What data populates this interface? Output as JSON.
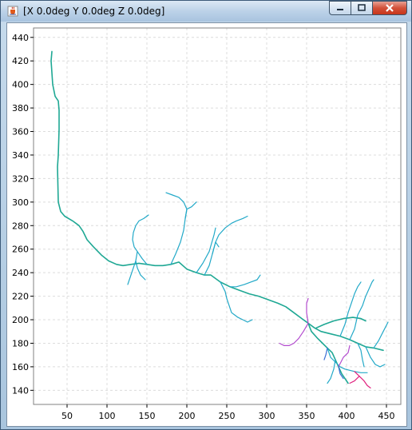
{
  "window": {
    "title": "[X 0.0deg Y 0.0deg Z 0.0deg]",
    "controls": {
      "minimize": "minimize",
      "maximize": "maximize",
      "close": "close"
    },
    "icon": "java-cup-icon"
  },
  "colors": {
    "grid": "#dcdcdc",
    "axis": "#000000",
    "trunk": "#1fa894",
    "branch": "#22a9c8",
    "purple": "#b34ccf",
    "pink": "#e0227f",
    "blue": "#3a6fd6"
  },
  "chart_data": {
    "type": "line",
    "title": "",
    "xlabel": "",
    "ylabel": "",
    "xlim": [
      8,
      468
    ],
    "ylim": [
      128,
      448
    ],
    "xticks": [
      50,
      100,
      150,
      200,
      250,
      300,
      350,
      400,
      450
    ],
    "yticks": [
      140,
      160,
      180,
      200,
      220,
      240,
      260,
      280,
      300,
      320,
      340,
      360,
      380,
      400,
      420,
      440
    ],
    "grid": true,
    "series": [
      {
        "color": "trunk",
        "points": [
          [
            31,
            428
          ],
          [
            30,
            420
          ],
          [
            32,
            400
          ],
          [
            35,
            390
          ],
          [
            39,
            386
          ],
          [
            40,
            378
          ],
          [
            40,
            362
          ],
          [
            39,
            340
          ],
          [
            38,
            330
          ],
          [
            39,
            300
          ],
          [
            42,
            292
          ],
          [
            47,
            288
          ],
          [
            57,
            284
          ],
          [
            65,
            280
          ],
          [
            70,
            275
          ],
          [
            75,
            268
          ],
          [
            83,
            262
          ],
          [
            93,
            255
          ],
          [
            102,
            250
          ],
          [
            112,
            247
          ],
          [
            120,
            246
          ],
          [
            130,
            247
          ],
          [
            140,
            248
          ],
          [
            150,
            247
          ],
          [
            160,
            246
          ],
          [
            170,
            246
          ],
          [
            180,
            247
          ],
          [
            190,
            249
          ],
          [
            200,
            243
          ],
          [
            212,
            240
          ],
          [
            222,
            238
          ],
          [
            230,
            238
          ],
          [
            242,
            232
          ],
          [
            254,
            228
          ],
          [
            266,
            225
          ],
          [
            278,
            222
          ],
          [
            290,
            220
          ],
          [
            302,
            217
          ],
          [
            314,
            214
          ],
          [
            324,
            211
          ],
          [
            334,
            206
          ],
          [
            344,
            201
          ],
          [
            352,
            197
          ],
          [
            360,
            193
          ],
          [
            368,
            190
          ],
          [
            380,
            188
          ],
          [
            392,
            186
          ],
          [
            404,
            183
          ],
          [
            414,
            180
          ],
          [
            424,
            177
          ],
          [
            434,
            176
          ],
          [
            446,
            174
          ]
        ]
      },
      {
        "color": "trunk",
        "points": [
          [
            352,
            197
          ],
          [
            356,
            190
          ],
          [
            364,
            184
          ],
          [
            370,
            180
          ],
          [
            376,
            176
          ],
          [
            382,
            172
          ],
          [
            386,
            166
          ],
          [
            390,
            160
          ],
          [
            394,
            154
          ],
          [
            398,
            150
          ],
          [
            402,
            146
          ]
        ]
      },
      {
        "color": "trunk",
        "points": [
          [
            362,
            193
          ],
          [
            372,
            196
          ],
          [
            384,
            199
          ],
          [
            396,
            201
          ],
          [
            408,
            202
          ],
          [
            418,
            201
          ],
          [
            424,
            199
          ]
        ]
      },
      {
        "color": "branch",
        "points": [
          [
            150,
            247
          ],
          [
            144,
            252
          ],
          [
            138,
            258
          ],
          [
            134,
            262
          ],
          [
            132,
            268
          ],
          [
            133,
            274
          ],
          [
            136,
            280
          ],
          [
            140,
            284
          ],
          [
            146,
            286
          ],
          [
            152,
            289
          ]
        ]
      },
      {
        "color": "branch",
        "points": [
          [
            138,
            258
          ],
          [
            136,
            250
          ],
          [
            138,
            244
          ],
          [
            142,
            238
          ],
          [
            148,
            234
          ]
        ]
      },
      {
        "color": "branch",
        "points": [
          [
            136,
            250
          ],
          [
            132,
            242
          ],
          [
            128,
            234
          ],
          [
            126,
            230
          ]
        ]
      },
      {
        "color": "branch",
        "points": [
          [
            180,
            247
          ],
          [
            186,
            256
          ],
          [
            192,
            266
          ],
          [
            196,
            276
          ],
          [
            198,
            286
          ],
          [
            200,
            294
          ],
          [
            196,
            300
          ],
          [
            190,
            304
          ],
          [
            182,
            306
          ],
          [
            174,
            308
          ]
        ]
      },
      {
        "color": "branch",
        "points": [
          [
            198,
            286
          ],
          [
            200,
            294
          ],
          [
            206,
            296
          ],
          [
            212,
            300
          ]
        ]
      },
      {
        "color": "branch",
        "points": [
          [
            212,
            240
          ],
          [
            220,
            248
          ],
          [
            228,
            258
          ],
          [
            234,
            272
          ],
          [
            236,
            278
          ]
        ]
      },
      {
        "color": "branch",
        "points": [
          [
            222,
            238
          ],
          [
            228,
            246
          ],
          [
            232,
            256
          ],
          [
            236,
            266
          ],
          [
            240,
            272
          ],
          [
            248,
            278
          ],
          [
            256,
            282
          ],
          [
            262,
            284
          ],
          [
            270,
            286
          ],
          [
            276,
            288
          ]
        ]
      },
      {
        "color": "branch",
        "points": [
          [
            232,
            256
          ],
          [
            236,
            266
          ],
          [
            240,
            262
          ]
        ]
      },
      {
        "color": "branch",
        "points": [
          [
            242,
            232
          ],
          [
            248,
            224
          ],
          [
            250,
            218
          ],
          [
            252,
            214
          ],
          [
            254,
            210
          ],
          [
            256,
            206
          ],
          [
            260,
            204
          ],
          [
            264,
            202
          ],
          [
            270,
            200
          ],
          [
            276,
            198
          ],
          [
            282,
            200
          ]
        ]
      },
      {
        "color": "branch",
        "points": [
          [
            254,
            228
          ],
          [
            262,
            228
          ],
          [
            272,
            230
          ],
          [
            280,
            232
          ],
          [
            288,
            234
          ],
          [
            292,
            238
          ]
        ]
      },
      {
        "color": "branch",
        "points": [
          [
            376,
            176
          ],
          [
            380,
            168
          ],
          [
            386,
            164
          ],
          [
            392,
            160
          ],
          [
            398,
            158
          ],
          [
            404,
            157
          ],
          [
            410,
            156
          ],
          [
            418,
            155
          ],
          [
            426,
            155
          ]
        ]
      },
      {
        "color": "branch",
        "points": [
          [
            386,
            166
          ],
          [
            384,
            158
          ],
          [
            380,
            150
          ],
          [
            376,
            146
          ]
        ]
      },
      {
        "color": "branch",
        "points": [
          [
            404,
            183
          ],
          [
            410,
            192
          ],
          [
            414,
            204
          ],
          [
            420,
            212
          ],
          [
            424,
            220
          ],
          [
            428,
            226
          ],
          [
            432,
            232
          ],
          [
            434,
            234
          ]
        ]
      },
      {
        "color": "branch",
        "points": [
          [
            392,
            186
          ],
          [
            398,
            196
          ],
          [
            402,
            206
          ],
          [
            406,
            214
          ],
          [
            410,
            222
          ],
          [
            414,
            228
          ],
          [
            418,
            232
          ]
        ]
      },
      {
        "color": "branch",
        "points": [
          [
            424,
            177
          ],
          [
            430,
            168
          ],
          [
            436,
            162
          ],
          [
            442,
            160
          ],
          [
            448,
            162
          ]
        ]
      },
      {
        "color": "branch",
        "points": [
          [
            434,
            176
          ],
          [
            440,
            182
          ],
          [
            446,
            190
          ],
          [
            452,
            198
          ]
        ]
      },
      {
        "color": "branch",
        "points": [
          [
            414,
            180
          ],
          [
            418,
            174
          ],
          [
            420,
            166
          ],
          [
            422,
            160
          ]
        ]
      },
      {
        "color": "purple",
        "points": [
          [
            352,
            197
          ],
          [
            346,
            190
          ],
          [
            340,
            184
          ],
          [
            334,
            180
          ],
          [
            328,
            178
          ],
          [
            322,
            178
          ],
          [
            316,
            180
          ]
        ]
      },
      {
        "color": "purple",
        "points": [
          [
            352,
            197
          ],
          [
            350,
            206
          ],
          [
            350,
            214
          ],
          [
            352,
            218
          ]
        ]
      },
      {
        "color": "purple",
        "points": [
          [
            390,
            160
          ],
          [
            396,
            168
          ],
          [
            402,
            172
          ],
          [
            404,
            178
          ]
        ]
      },
      {
        "color": "pink",
        "points": [
          [
            410,
            156
          ],
          [
            416,
            152
          ],
          [
            422,
            148
          ],
          [
            426,
            144
          ],
          [
            430,
            142
          ]
        ]
      },
      {
        "color": "pink",
        "points": [
          [
            416,
            152
          ],
          [
            410,
            148
          ],
          [
            404,
            146
          ]
        ]
      },
      {
        "color": "blue",
        "points": [
          [
            376,
            176
          ],
          [
            374,
            170
          ],
          [
            372,
            166
          ]
        ]
      },
      {
        "color": "blue",
        "points": [
          [
            390,
            160
          ],
          [
            392,
            154
          ],
          [
            396,
            150
          ]
        ]
      }
    ]
  }
}
